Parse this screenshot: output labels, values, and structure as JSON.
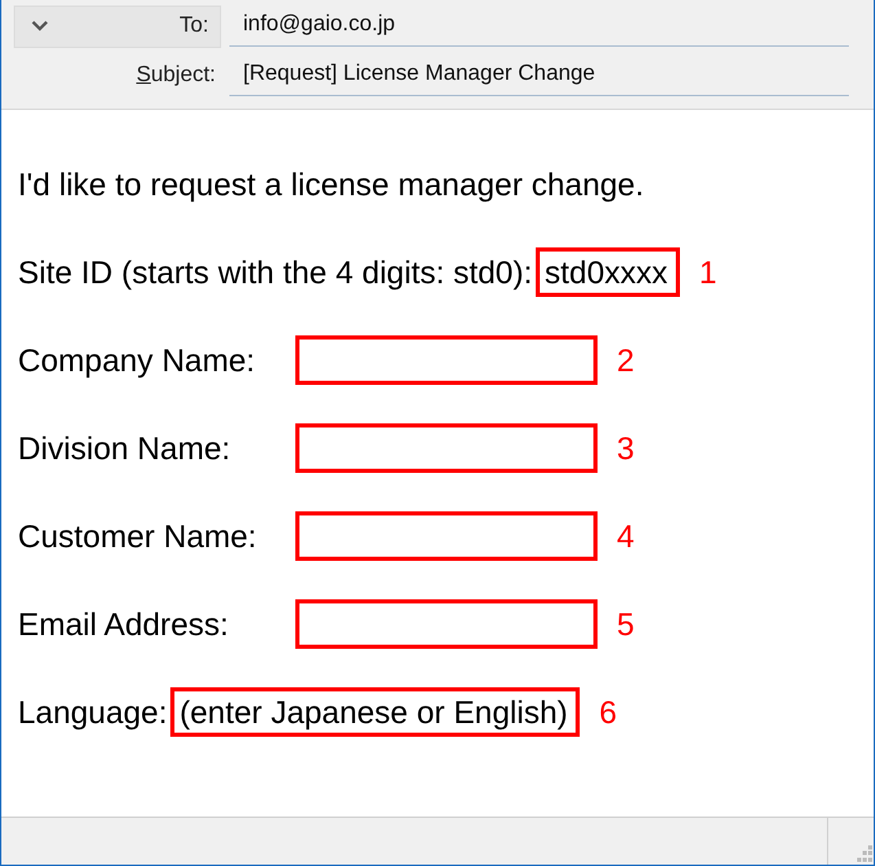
{
  "header": {
    "to": {
      "label": "To:",
      "value": "info@gaio.co.jp"
    },
    "subject": {
      "label": "Subject:",
      "value": "[Request] License Manager Change"
    }
  },
  "body": {
    "intro": "I'd like to request a license manager change.",
    "fields": [
      {
        "kind": "inline",
        "label": "Site ID (starts with the 4 digits: std0):",
        "value": "std0xxxx",
        "number": "1"
      },
      {
        "kind": "blank",
        "label": "Company Name:",
        "number": "2"
      },
      {
        "kind": "blank",
        "label": "Division Name:",
        "number": "3"
      },
      {
        "kind": "blank",
        "label": "Customer Name:",
        "number": "4"
      },
      {
        "kind": "blank",
        "label": "Email Address:",
        "number": "5"
      },
      {
        "kind": "inline",
        "label": "Language:",
        "value": "(enter Japanese or English)",
        "number": "6"
      }
    ]
  }
}
